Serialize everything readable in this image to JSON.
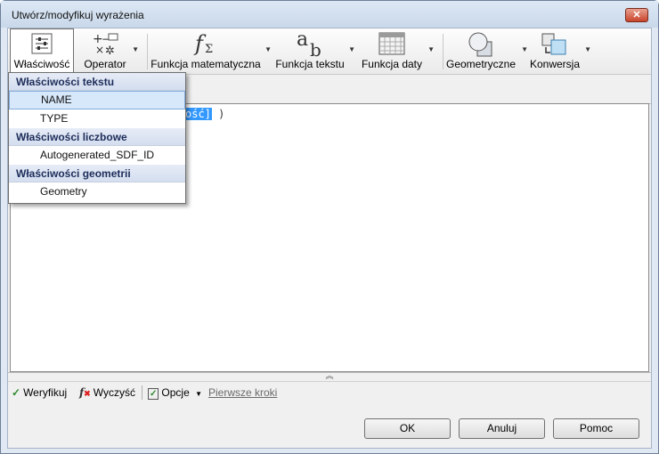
{
  "window": {
    "title": "Utwórz/modyfikuj wyrażenia",
    "close_glyph": "✕"
  },
  "toolbar": {
    "items": [
      {
        "label": "Właściwość",
        "icon": "properties-icon"
      },
      {
        "label": "Operator",
        "icon": "operator-icon"
      },
      {
        "label": "Funkcja matematyczna",
        "icon": "math-function-icon"
      },
      {
        "label": "Funkcja tekstu",
        "icon": "text-function-icon"
      },
      {
        "label": "Funkcja daty",
        "icon": "date-function-icon"
      },
      {
        "label": "Geometryczne",
        "icon": "geometry-icon"
      },
      {
        "label": "Konwersja",
        "icon": "conversion-icon"
      }
    ]
  },
  "editor": {
    "selected_text": "ość]",
    "rest_text": " )"
  },
  "dropdown": {
    "groups": [
      {
        "title": "Właściwości tekstu",
        "items": [
          "NAME",
          "TYPE"
        ]
      },
      {
        "title": "Właściwości liczbowe",
        "items": [
          "Autogenerated_SDF_ID"
        ]
      },
      {
        "title": "Właściwości geometrii",
        "items": [
          "Geometry"
        ]
      }
    ],
    "selected_item": "NAME"
  },
  "actions": {
    "verify": "Weryfikuj",
    "clear": "Wyczyść",
    "options": "Opcje",
    "first_steps": "Pierwsze kroki"
  },
  "buttons": {
    "ok": "OK",
    "cancel": "Anuluj",
    "help": "Pomoc"
  },
  "splitter_glyph": "︽",
  "colors": {
    "selection": "#3399ff",
    "group_header": "#1e2d5a",
    "accent": "#84acdd"
  }
}
